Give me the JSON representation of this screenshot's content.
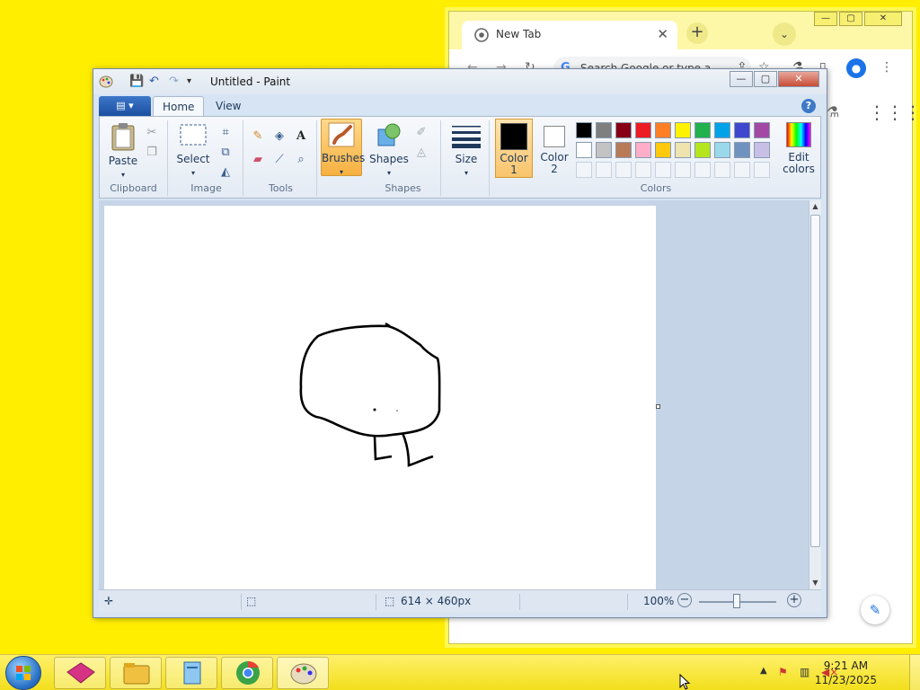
{
  "chrome": {
    "tab_title": "New Tab",
    "tab_close": "✕",
    "new_tab": "+",
    "tab_search": "⌄",
    "omnibox_placeholder": "Search Google or type a",
    "google_g": "G",
    "minimize": "—",
    "maximize": "▢",
    "close": "✕"
  },
  "paint": {
    "title": "Untitled - Paint",
    "minimize": "—",
    "maximize": "▢",
    "close": "✕",
    "file_menu": "▤ ▾",
    "help": "?",
    "tabs": [
      {
        "label": "Home",
        "active": true
      },
      {
        "label": "View",
        "active": false
      }
    ],
    "groups": {
      "clipboard": {
        "label": "Clipboard",
        "paste": "Paste"
      },
      "image": {
        "label": "Image",
        "select": "Select"
      },
      "tools": {
        "label": "Tools"
      },
      "brushes": {
        "label": "Brushes"
      },
      "shapes": {
        "label": "Shapes",
        "shapes": "Shapes"
      },
      "size": {
        "label": "Size"
      },
      "colors": {
        "label": "Colors",
        "color1": "Color 1",
        "color1_line1": "Color",
        "color1_line2": "1",
        "color2_line1": "Color",
        "color2_line2": "2",
        "edit_line1": "Edit",
        "edit_line2": "colors"
      }
    },
    "palette_row1": [
      "#000000",
      "#7f7f7f",
      "#880015",
      "#ed1c24",
      "#ff7f27",
      "#fff200",
      "#22b14c",
      "#00a2e8",
      "#3f48cc",
      "#a349a4"
    ],
    "palette_row2": [
      "#ffffff",
      "#c3c3c3",
      "#b97a57",
      "#ffaec9",
      "#ffc90e",
      "#efe4b0",
      "#b5e61d",
      "#99d9ea",
      "#7092be",
      "#c8bfe7"
    ],
    "primary_color": "#000000",
    "secondary_color": "#ffffff",
    "status": {
      "dimensions": "614 × 460px",
      "zoom": "100%"
    }
  },
  "taskbar": {
    "time": "9:21 AM",
    "date": "11/23/2025",
    "tray_arrow": "▲"
  },
  "colors": {
    "desktop": "#ffee00",
    "accent": "#1a73e8"
  }
}
